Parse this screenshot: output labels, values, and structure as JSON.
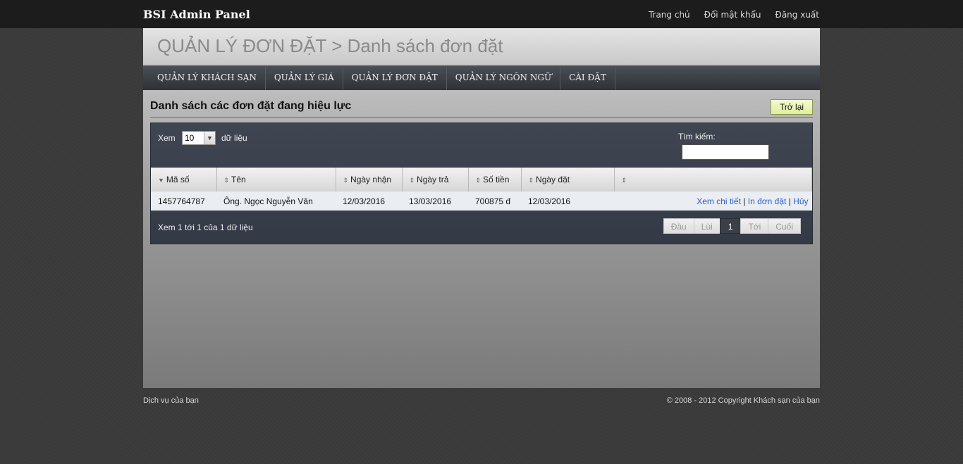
{
  "topbar": {
    "brand": "BSI Admin Panel",
    "links": [
      "Trang chủ",
      "Đổi mật khẩu",
      "Đăng xuất"
    ]
  },
  "header": {
    "title": "QUẢN LÝ ĐƠN ĐẶT > Danh sách đơn đặt"
  },
  "mainnav": [
    "QUẢN LÝ KHÁCH SẠN",
    "QUẢN LÝ GIÁ",
    "QUẢN LÝ ĐƠN ĐẶT",
    "QUẢN LÝ NGÔN NGỮ",
    "CÀI ĐẶT"
  ],
  "section": {
    "title": "Danh sách các đơn đặt đang hiệu lực",
    "back_label": "Trở lại"
  },
  "table_controls": {
    "length_label": "Xem",
    "length_value": "10",
    "length_suffix": "dữ liệu",
    "search_label": "Tìm kiếm:"
  },
  "table": {
    "columns": [
      "Mã số",
      "Tên",
      "Ngày nhận",
      "Ngày trả",
      "Số tiền",
      "Ngày đặt",
      ""
    ],
    "rows": [
      {
        "ma_so": "1457764787",
        "ten": "Ông. Ngọc Nguyễn Văn",
        "ngay_nhan": "12/03/2016",
        "ngay_tra": "13/03/2016",
        "so_tien": "700875 đ",
        "ngay_dat": "12/03/2016",
        "actions": [
          "Xem chi tiết",
          "In đơn đặt",
          "Hủy"
        ]
      }
    ]
  },
  "pagination": {
    "info": "Xem 1 tới 1 của 1 dữ liệu",
    "first": "Đầu",
    "prev": "Lùi",
    "current": "1",
    "next": "Tới",
    "last": "Cuối"
  },
  "footer": {
    "left": "Dịch vụ của bạn",
    "right": "© 2008 - 2012 Copyright Khách sạn của bạn"
  }
}
